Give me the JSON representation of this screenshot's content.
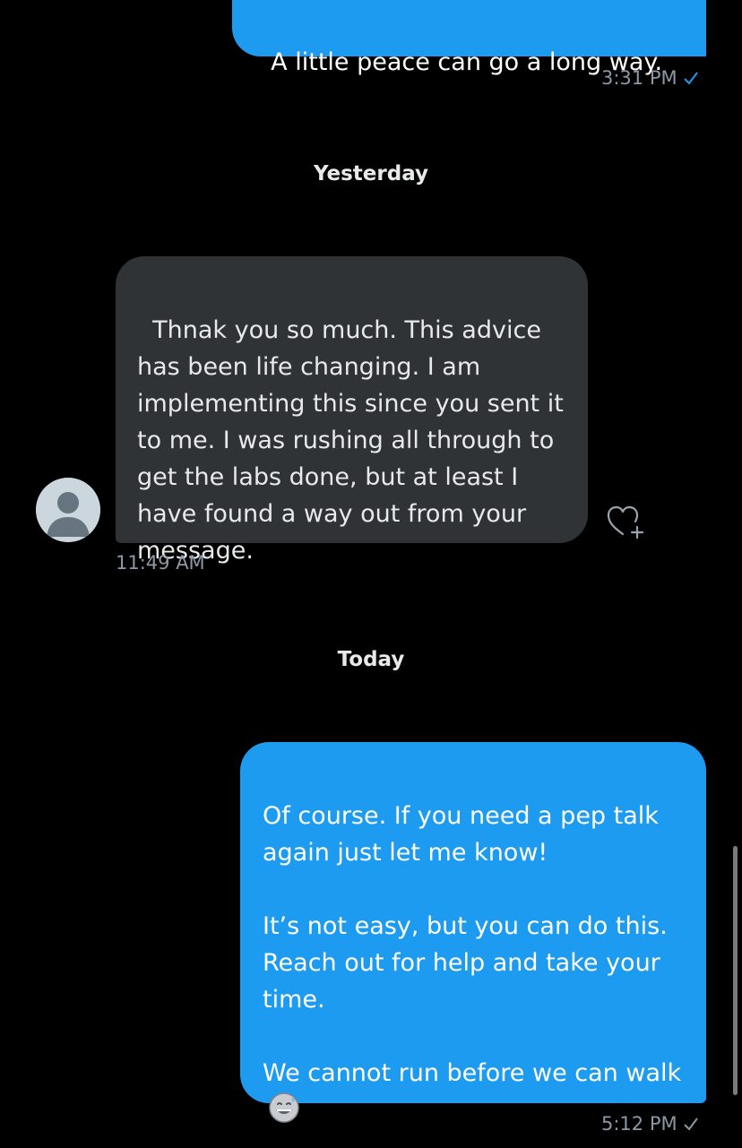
{
  "messages": [
    {
      "direction": "outgoing",
      "text": "A little peace can go a long way.",
      "time": "3:31 PM",
      "status_icon": "check-icon",
      "status_color": "#1d9bf0"
    },
    {
      "direction": "incoming",
      "text": "Thnak you so much. This advice has been life changing. I am implementing this since you sent it to me. I was rushing all through to get the labs done, but at least I have found a way out from your message.",
      "time": "11:49 AM",
      "reaction_icon": "add-reaction-heart-icon"
    },
    {
      "direction": "outgoing",
      "paragraphs": [
        "Of course. If you need a pep talk again just let me know!",
        "It’s not easy, but you can do this. Reach out for help and take your time.",
        "We cannot run before we can walk"
      ],
      "emoji": "grinning-face-with-sweat-emoji",
      "time": "5:12 PM",
      "status_icon": "check-icon",
      "status_color": "#8b98a5"
    }
  ],
  "separators": {
    "yesterday": "Yesterday",
    "today": "Today"
  },
  "colors": {
    "background": "#000000",
    "outgoing_bubble": "#1d9bf0",
    "incoming_bubble": "#2f3336",
    "meta_text": "#8b98a5"
  }
}
